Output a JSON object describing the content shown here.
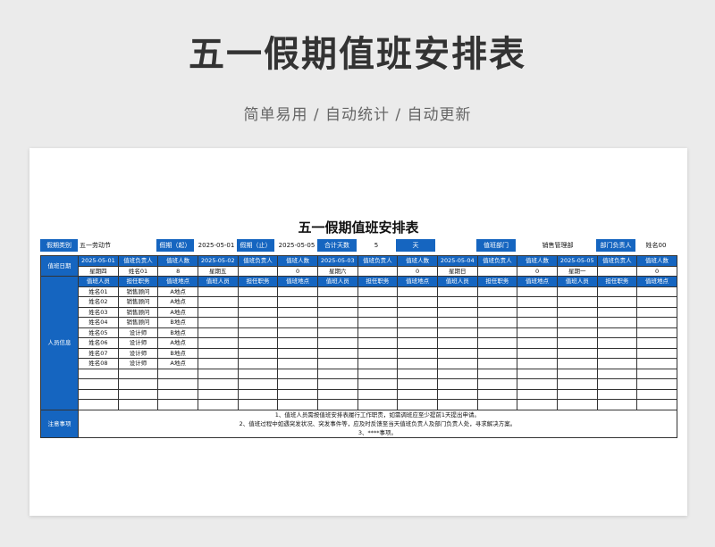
{
  "header": {
    "title": "五一假期值班安排表",
    "subtitle": "简单易用 / 自动统计 / 自动更新"
  },
  "sheet": {
    "title": "五一假期值班安排表",
    "info": {
      "holiday_type_label": "假期类别",
      "holiday_type_value": "五一劳动节",
      "start_label": "假期（起）",
      "start_value": "2025-05-01",
      "end_label": "假期（止）",
      "end_value": "2025-05-05",
      "total_days_label": "合计天数",
      "total_days_value": "5",
      "days_unit": "天",
      "dept_label": "值班部门",
      "dept_value": "销售管理部",
      "head_label": "部门负责人",
      "head_value": "姓名00"
    },
    "side_labels": {
      "duty_date": "值班日期",
      "personnel": "人员信息",
      "notes": "注意事项"
    },
    "day_headers": {
      "person_in_charge": "值班负责人",
      "count": "值班人数"
    },
    "days": [
      {
        "date": "2025-05-01",
        "weekday": "星期四",
        "head": "姓名01",
        "count": "8"
      },
      {
        "date": "2025-05-02",
        "weekday": "星期五",
        "head": "",
        "count": "0"
      },
      {
        "date": "2025-05-03",
        "weekday": "星期六",
        "head": "",
        "count": "0"
      },
      {
        "date": "2025-05-04",
        "weekday": "星期日",
        "head": "",
        "count": "0"
      },
      {
        "date": "2025-05-05",
        "weekday": "星期一",
        "head": "",
        "count": "0"
      }
    ],
    "sub_headers": [
      "值班人员",
      "担任职务",
      "值班地点"
    ],
    "staff": [
      [
        "姓名01",
        "销售顾问",
        "A地点"
      ],
      [
        "姓名02",
        "销售顾问",
        "A地点"
      ],
      [
        "姓名03",
        "销售顾问",
        "A地点"
      ],
      [
        "姓名04",
        "销售顾问",
        "B地点"
      ],
      [
        "姓名05",
        "设计师",
        "B地点"
      ],
      [
        "姓名06",
        "设计师",
        "A地点"
      ],
      [
        "姓名07",
        "设计师",
        "B地点"
      ],
      [
        "姓名08",
        "设计师",
        "A地点"
      ]
    ],
    "notes": [
      "1、值班人员需按值班安排表履行工作职责，如需调班应至少提前1天提出申请。",
      "2、值班过程中如遇突发状况、突发事件等，应及时反馈至当天值班负责人及部门负责人处，寻求解决方案。",
      "3、****事项。"
    ]
  }
}
